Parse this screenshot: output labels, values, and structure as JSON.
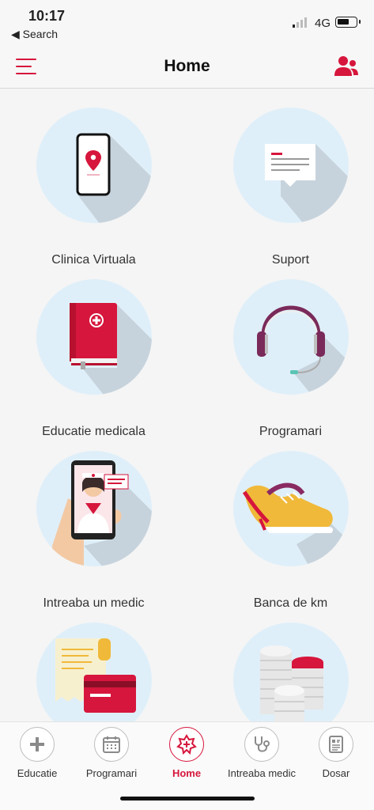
{
  "status_bar": {
    "time": "10:17",
    "back_label": "◀ Search",
    "network": "4G"
  },
  "header": {
    "title": "Home"
  },
  "tiles": [
    {
      "label": "Clinica Virtuala",
      "icon": "phone-location-icon"
    },
    {
      "label": "Suport",
      "icon": "message-icon"
    },
    {
      "label": "Educatie medicala",
      "icon": "medical-book-icon"
    },
    {
      "label": "Programari",
      "icon": "headset-icon"
    },
    {
      "label": "Intreaba un medic",
      "icon": "doctor-phone-icon"
    },
    {
      "label": "Banca de km",
      "icon": "sneaker-icon"
    },
    {
      "label": "",
      "icon": "receipt-card-icon"
    },
    {
      "label": "",
      "icon": "coins-icon"
    }
  ],
  "tabs": [
    {
      "label": "Educatie",
      "icon": "plus-icon"
    },
    {
      "label": "Programari",
      "icon": "calendar-icon"
    },
    {
      "label": "Home",
      "icon": "home-star-icon",
      "active": true
    },
    {
      "label": "Intreaba medic",
      "icon": "stethoscope-icon"
    },
    {
      "label": "Dosar",
      "icon": "document-icon"
    }
  ],
  "colors": {
    "accent": "#d6163c",
    "circle": "#dfeff9",
    "background": "#f5f5f5"
  }
}
